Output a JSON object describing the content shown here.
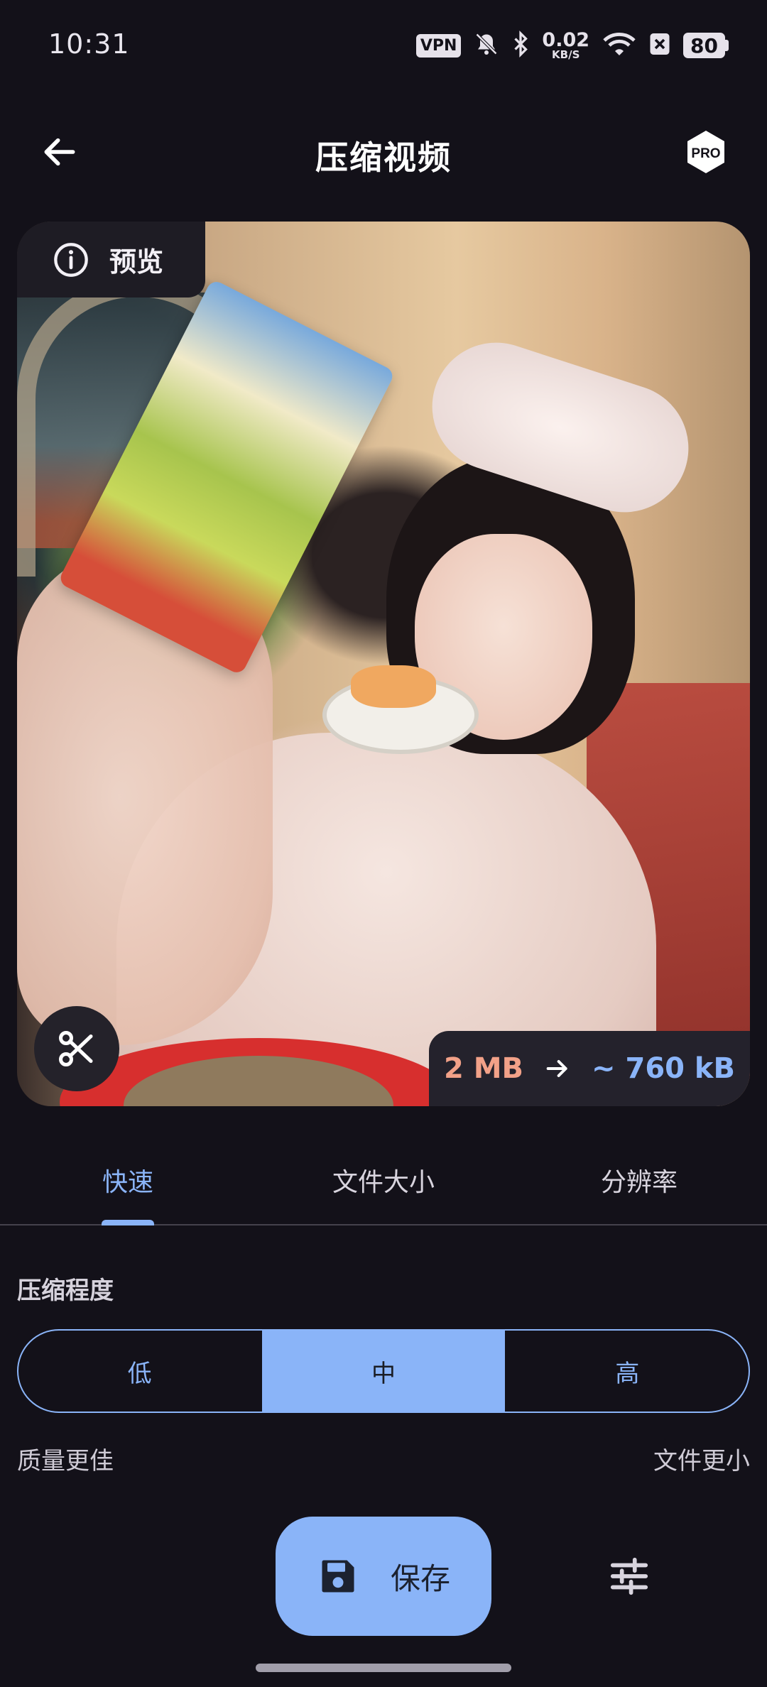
{
  "status_bar": {
    "time": "10:31",
    "vpn_label": "VPN",
    "net_speed_value": "0.02",
    "net_speed_unit": "KB/S",
    "battery": "80",
    "icons": [
      "mute-bell-icon",
      "bluetooth-icon",
      "wifi-icon",
      "close-box-icon"
    ]
  },
  "app_bar": {
    "title": "压缩视频",
    "back_icon": "arrow-left-icon",
    "pro_label": "PRO"
  },
  "preview": {
    "badge_label": "预览",
    "badge_icon": "info-icon",
    "trim_icon": "scissors-icon",
    "size_from": "2 MB",
    "size_to": "~ 760 kB",
    "size_from_color": "#f2a188",
    "size_to_color": "#8ab4f8"
  },
  "tabs": [
    {
      "label": "快速",
      "active": true
    },
    {
      "label": "文件大小",
      "active": false
    },
    {
      "label": "分辨率",
      "active": false
    }
  ],
  "compression": {
    "title": "压缩程度",
    "options": [
      "低",
      "中",
      "高"
    ],
    "selected": "中",
    "hint_left": "质量更佳",
    "hint_right": "文件更小"
  },
  "actions": {
    "save_label": "保存",
    "save_icon": "floppy-disk-icon",
    "settings_icon": "sliders-icon"
  },
  "colors": {
    "accent": "#8ab4f8",
    "background": "#131119"
  }
}
